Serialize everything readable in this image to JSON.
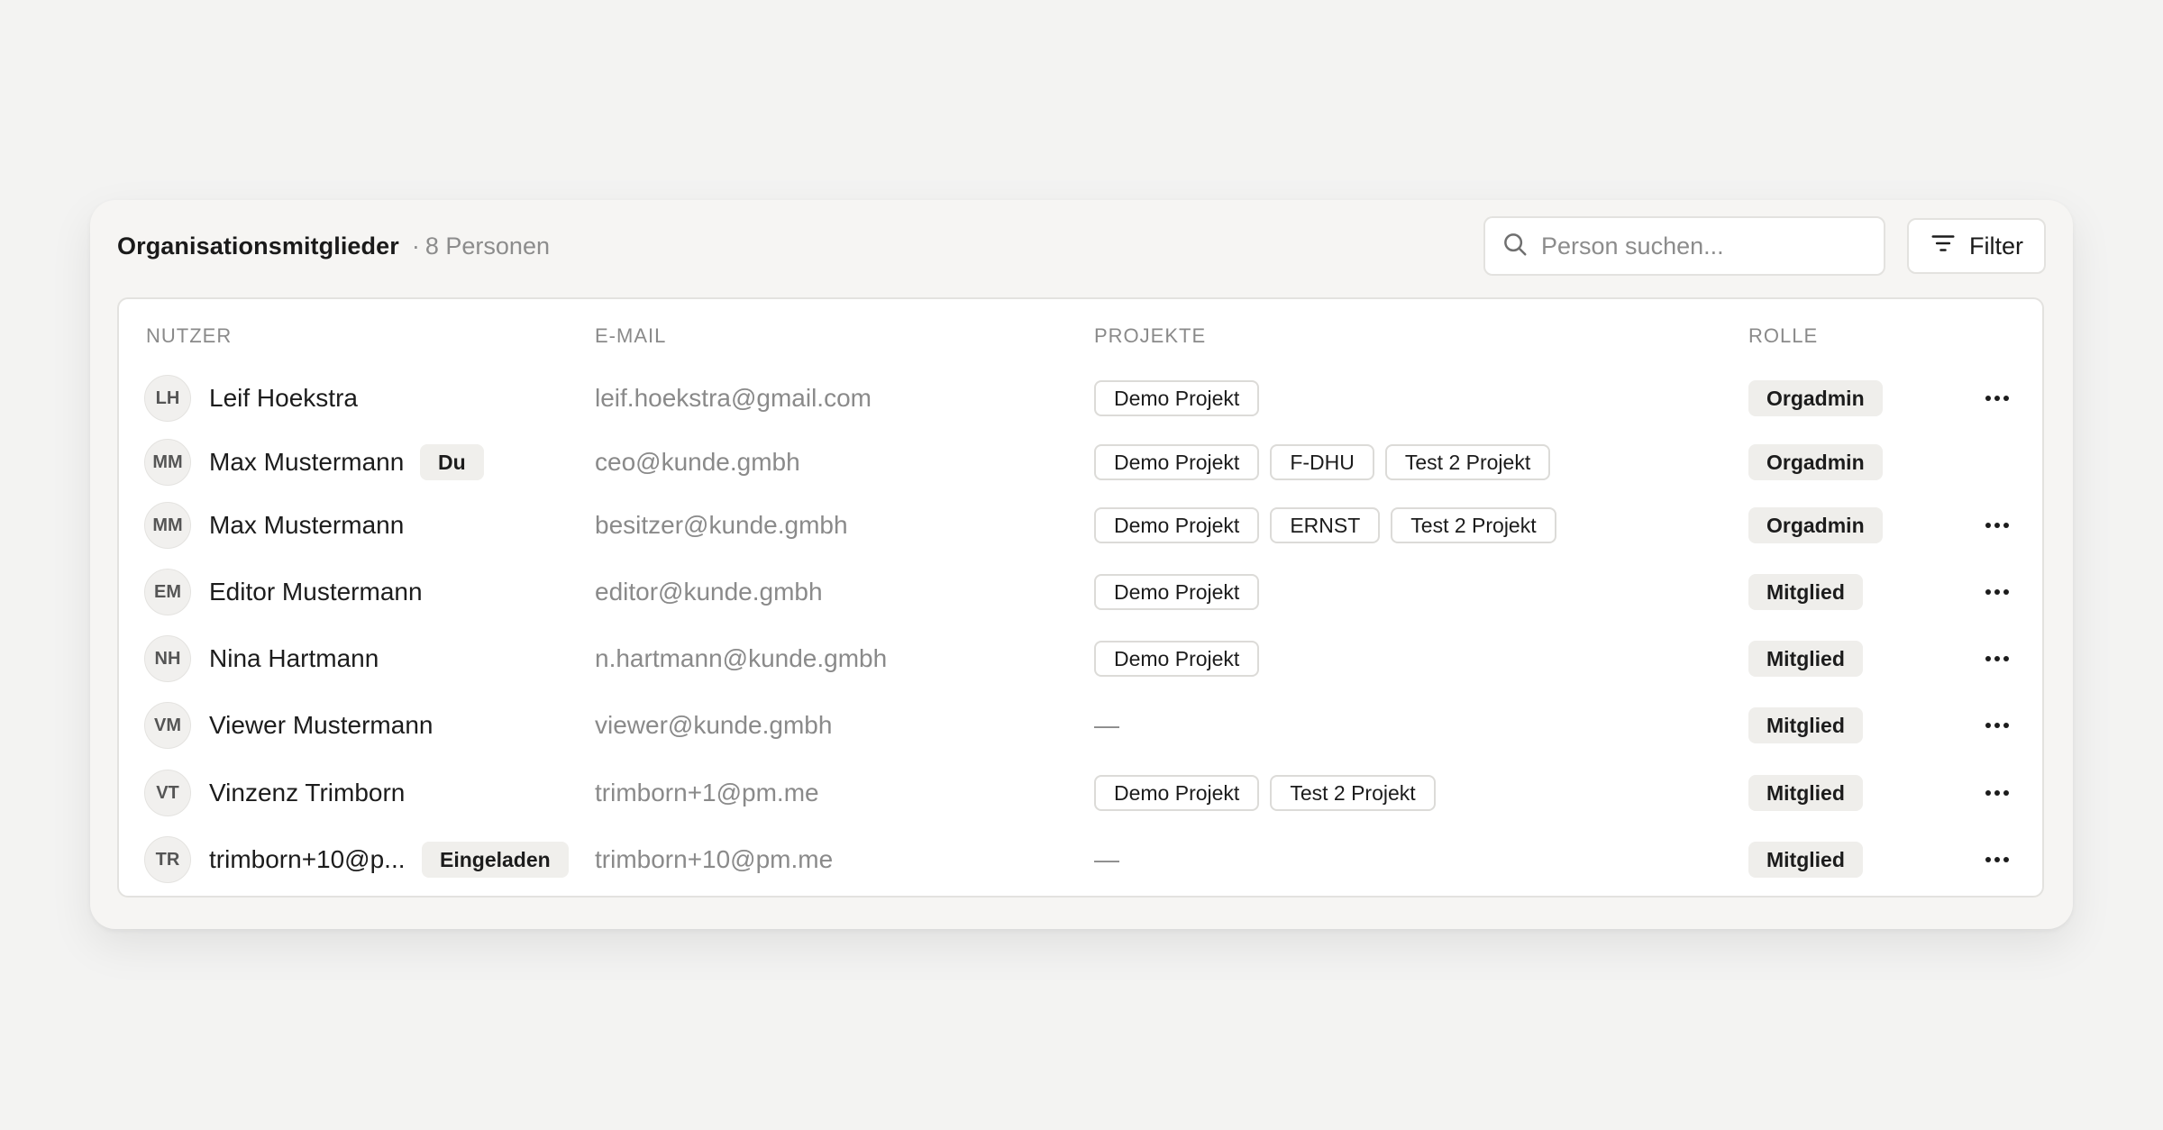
{
  "header": {
    "title": "Organisationsmitglieder",
    "count": "8 Personen",
    "search_placeholder": "Person suchen...",
    "filter_label": "Filter"
  },
  "columns": {
    "user": "NUTZER",
    "email": "E-MAIL",
    "projects": "PROJEKTE",
    "role": "ROLLE"
  },
  "members": [
    {
      "initials": "LH",
      "name": "Leif Hoekstra",
      "badge": "",
      "email": "leif.hoekstra@gmail.com",
      "projects": [
        "Demo Projekt"
      ],
      "role": "Orgadmin",
      "has_menu": true
    },
    {
      "initials": "MM",
      "name": "Max Mustermann",
      "badge": "Du",
      "email": "ceo@kunde.gmbh",
      "projects": [
        "Demo Projekt",
        "F-DHU",
        "Test 2 Projekt"
      ],
      "role": "Orgadmin",
      "has_menu": false
    },
    {
      "initials": "MM",
      "name": "Max Mustermann",
      "badge": "",
      "email": "besitzer@kunde.gmbh",
      "projects": [
        "Demo Projekt",
        "ERNST",
        "Test 2 Projekt"
      ],
      "role": "Orgadmin",
      "has_menu": true
    },
    {
      "initials": "EM",
      "name": "Editor Mustermann",
      "badge": "",
      "email": "editor@kunde.gmbh",
      "projects": [
        "Demo Projekt"
      ],
      "role": "Mitglied",
      "has_menu": true
    },
    {
      "initials": "NH",
      "name": "Nina Hartmann",
      "badge": "",
      "email": "n.hartmann@kunde.gmbh",
      "projects": [
        "Demo Projekt"
      ],
      "role": "Mitglied",
      "has_menu": true
    },
    {
      "initials": "VM",
      "name": "Viewer Mustermann",
      "badge": "",
      "email": "viewer@kunde.gmbh",
      "projects": [],
      "role": "Mitglied",
      "has_menu": true
    },
    {
      "initials": "VT",
      "name": "Vinzenz Trimborn",
      "badge": "",
      "email": "trimborn+1@pm.me",
      "projects": [
        "Demo Projekt",
        "Test 2 Projekt"
      ],
      "role": "Mitglied",
      "has_menu": true
    },
    {
      "initials": "TR",
      "name": "trimborn+10@p...",
      "badge": "Eingeladen",
      "email": "trimborn+10@pm.me",
      "projects": [],
      "role": "Mitglied",
      "has_menu": true
    }
  ],
  "empty_projects": "—",
  "icons": {
    "search": "search-icon",
    "filter": "filter-icon",
    "more": "more-horizontal-icon"
  }
}
